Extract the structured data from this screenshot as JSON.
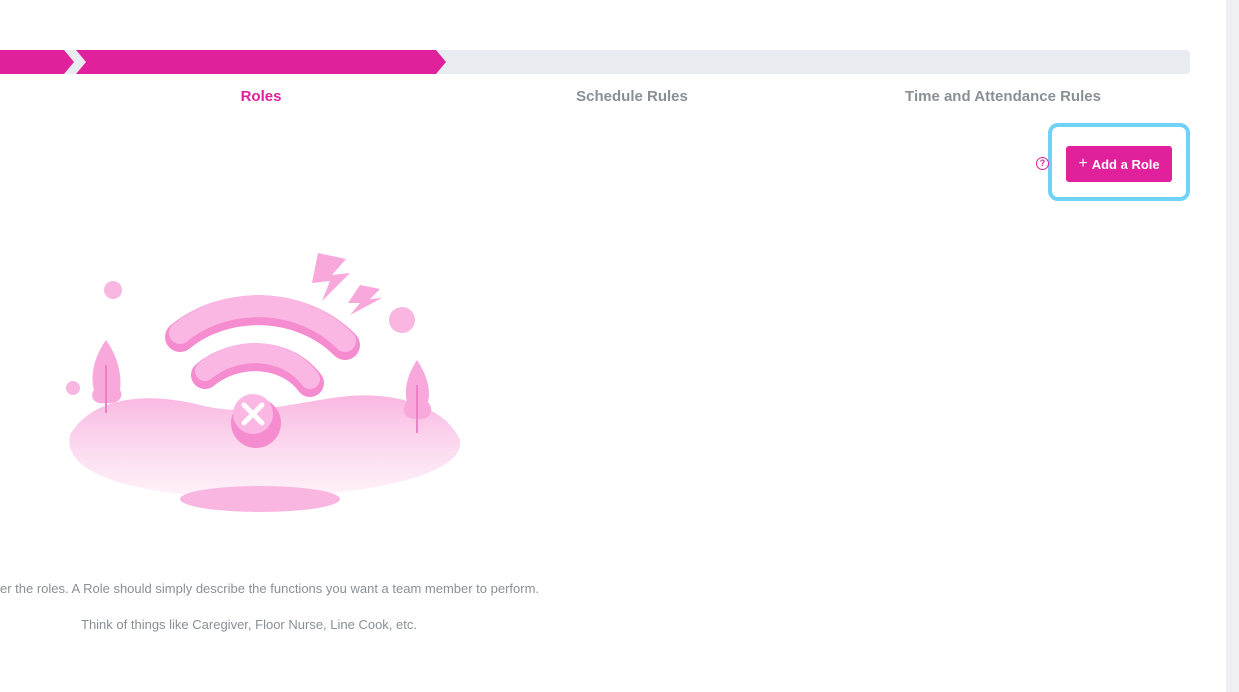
{
  "steps": {
    "roles": "Roles",
    "schedule": "Schedule Rules",
    "time": "Time and Attendance Rules"
  },
  "actions": {
    "add_role_label": "Add a Role",
    "add_role_icon": "plus-icon",
    "help_icon": "question-icon",
    "help_glyph": "?"
  },
  "empty_state": {
    "line1": "er the roles. A Role should simply describe the functions you want a team member to perform.",
    "line2": "Think of things like Caregiver, Floor Nurse, Line Cook, etc.",
    "illustration_icon": "no-wifi-illustration"
  },
  "colors": {
    "accent": "#e0219b",
    "track": "#e8ecf1",
    "highlight": "#6fd3f7",
    "muted_text": "#8a8f96"
  }
}
